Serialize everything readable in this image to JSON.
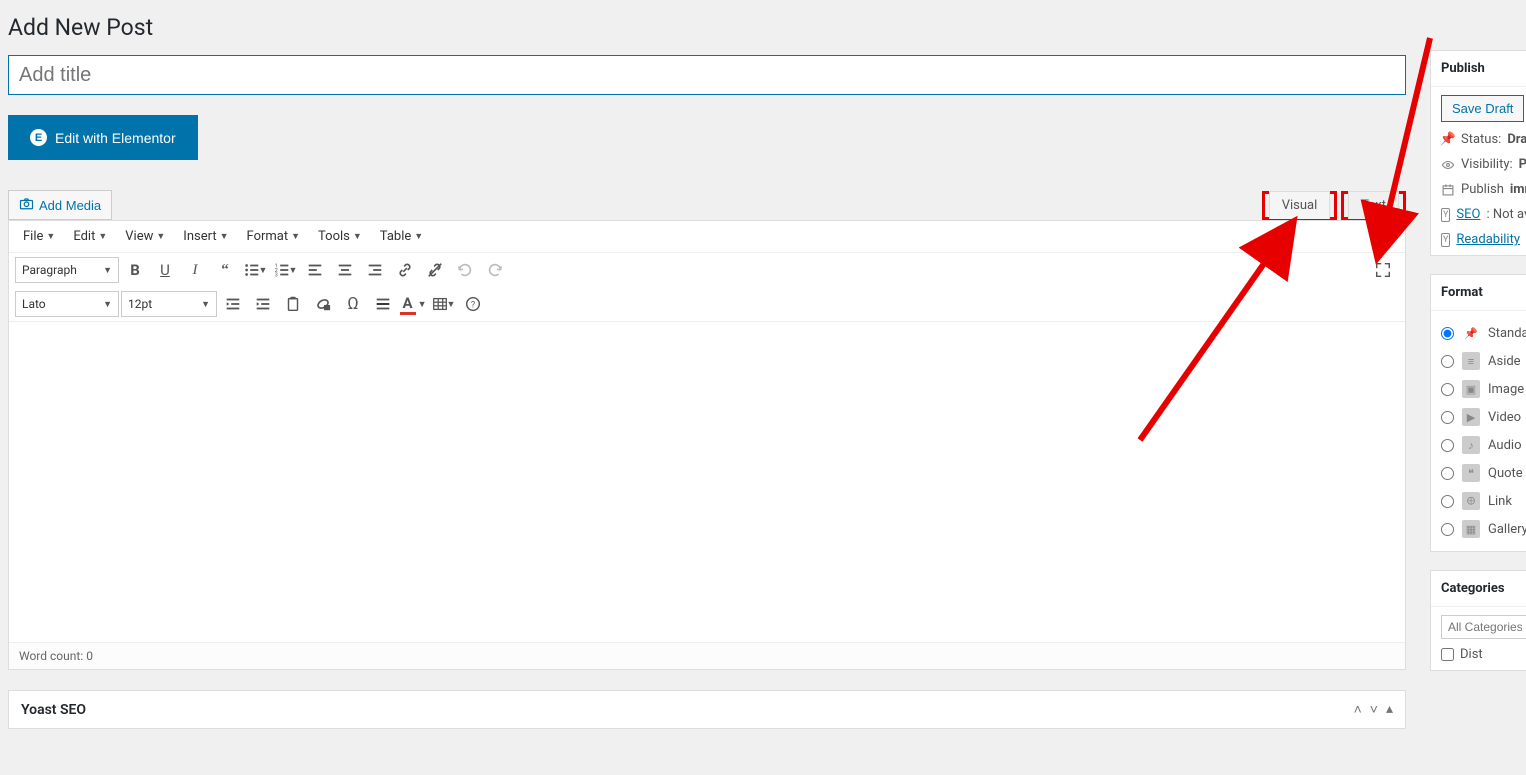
{
  "page_title": "Add New Post",
  "title_placeholder": "Add title",
  "elementor_button": "Edit with Elementor",
  "add_media": "Add Media",
  "tabs": {
    "visual": "Visual",
    "text": "Text"
  },
  "menubar": [
    "File",
    "Edit",
    "View",
    "Insert",
    "Format",
    "Tools",
    "Table"
  ],
  "format_select": "Paragraph",
  "font_select": "Lato",
  "size_select": "12pt",
  "wordcount_label": "Word count:",
  "wordcount_value": "0",
  "yoast_title": "Yoast SEO",
  "publish": {
    "heading": "Publish",
    "save_draft": "Save Draft",
    "status_label": "Status:",
    "status_value": "Draf",
    "visibility_label": "Visibility:",
    "visibility_value": "Pu",
    "publish_label": "Publish",
    "publish_value": "imm",
    "seo_link": "SEO",
    "seo_after": ": Not av",
    "readability_link": "Readability",
    "readability_after": ":"
  },
  "format_panel": {
    "heading": "Format",
    "options": [
      "Standa",
      "Aside",
      "Image",
      "Video",
      "Audio",
      "Quote",
      "Link",
      "Gallery"
    ],
    "selected": 0
  },
  "categories": {
    "heading": "Categories",
    "placeholder": "All Categories",
    "row_label": "Dist"
  },
  "toolbar_icons_row1": [
    "bold",
    "underline",
    "italic",
    "quote",
    "ul",
    "ol",
    "align-left",
    "align-center",
    "align-right",
    "link",
    "unlink",
    "undo",
    "redo"
  ],
  "toolbar_icons_row2": [
    "outdent",
    "indent",
    "paste",
    "clear",
    "omega",
    "hr",
    "textcolor",
    "table",
    "help"
  ]
}
